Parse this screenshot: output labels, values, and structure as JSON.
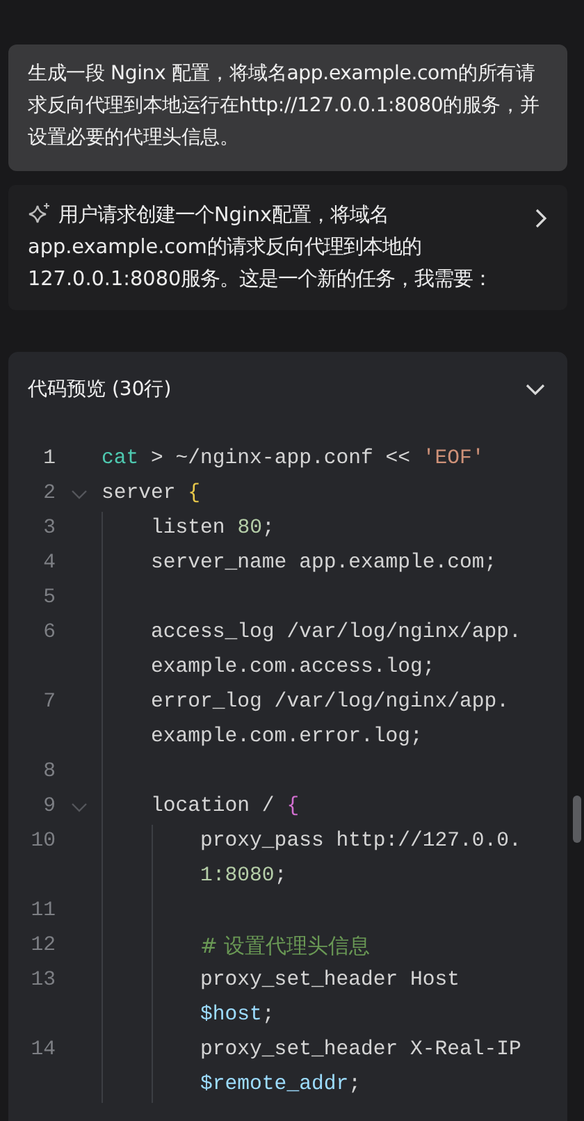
{
  "user_message": {
    "text": "生成一段 Nginx 配置，将域名app.example.com的所有请求反向代理到本地运行在http://127.0.0.1:8080的服务，并设置必要的代理头信息。"
  },
  "thinking": {
    "text": "用户请求创建一个Nginx配置，将域名app.example.com的请求反向代理到本地的127.0.0.1:8080服务。这是一个新的任务，我需要：",
    "expanded": false
  },
  "code_preview": {
    "title": "代码预览 (30行)",
    "expanded": true,
    "lines": [
      {
        "number": "1",
        "active": true,
        "rows": [
          [
            {
              "text": "cat",
              "kind": "command"
            },
            {
              "text": " > ~/nginx-app.conf << ",
              "kind": "plain"
            },
            {
              "text": "'EOF'",
              "kind": "string"
            }
          ]
        ]
      },
      {
        "number": "2",
        "active": false,
        "rows": [
          [
            {
              "text": "server ",
              "kind": "plain"
            },
            {
              "text": "{",
              "kind": "bracket1"
            }
          ]
        ],
        "children": [
          {
            "number": "3",
            "active": false,
            "rows": [
              [
                {
                  "text": "listen ",
                  "kind": "plain"
                },
                {
                  "text": "80",
                  "kind": "number"
                },
                {
                  "text": ";",
                  "kind": "plain"
                }
              ]
            ]
          },
          {
            "number": "4",
            "active": false,
            "rows": [
              [
                {
                  "text": "server_name app.example.com;",
                  "kind": "plain"
                }
              ]
            ]
          },
          {
            "number": "5",
            "active": false,
            "rows": [
              []
            ]
          },
          {
            "number": "6",
            "active": false,
            "rows": [
              [
                {
                  "text": "access_log /var/log/nginx/app.",
                  "kind": "plain"
                }
              ],
              [
                {
                  "text": "example.com.access.log;",
                  "kind": "plain"
                }
              ]
            ]
          },
          {
            "number": "7",
            "active": false,
            "rows": [
              [
                {
                  "text": "error_log /var/log/nginx/app.",
                  "kind": "plain"
                }
              ],
              [
                {
                  "text": "example.com.error.log;",
                  "kind": "plain"
                }
              ]
            ]
          },
          {
            "number": "8",
            "active": false,
            "rows": [
              []
            ]
          },
          {
            "number": "9",
            "active": false,
            "rows": [
              [
                {
                  "text": "location / ",
                  "kind": "plain"
                },
                {
                  "text": "{",
                  "kind": "bracket2"
                }
              ]
            ],
            "children": [
              {
                "number": "10",
                "active": false,
                "rows": [
                  [
                    {
                      "text": "proxy_pass http://127.0.0.",
                      "kind": "plain"
                    }
                  ],
                  [
                    {
                      "text": "1:8080",
                      "kind": "number"
                    },
                    {
                      "text": ";",
                      "kind": "plain"
                    }
                  ]
                ]
              },
              {
                "number": "11",
                "active": false,
                "rows": [
                  []
                ]
              },
              {
                "number": "12",
                "active": false,
                "rows": [
                  [
                    {
                      "text": "# 设置代理头信息",
                      "kind": "comment"
                    }
                  ]
                ]
              },
              {
                "number": "13",
                "active": false,
                "rows": [
                  [
                    {
                      "text": "proxy_set_header Host",
                      "kind": "plain"
                    }
                  ],
                  [
                    {
                      "text": "$host",
                      "kind": "variable"
                    },
                    {
                      "text": ";",
                      "kind": "plain"
                    }
                  ]
                ]
              },
              {
                "number": "14",
                "active": false,
                "rows": [
                  [
                    {
                      "text": "proxy_set_header X-Real-IP",
                      "kind": "plain"
                    }
                  ],
                  [
                    {
                      "text": "$remote_addr",
                      "kind": "variable"
                    },
                    {
                      "text": ";",
                      "kind": "plain"
                    }
                  ]
                ]
              }
            ]
          }
        ]
      }
    ]
  }
}
